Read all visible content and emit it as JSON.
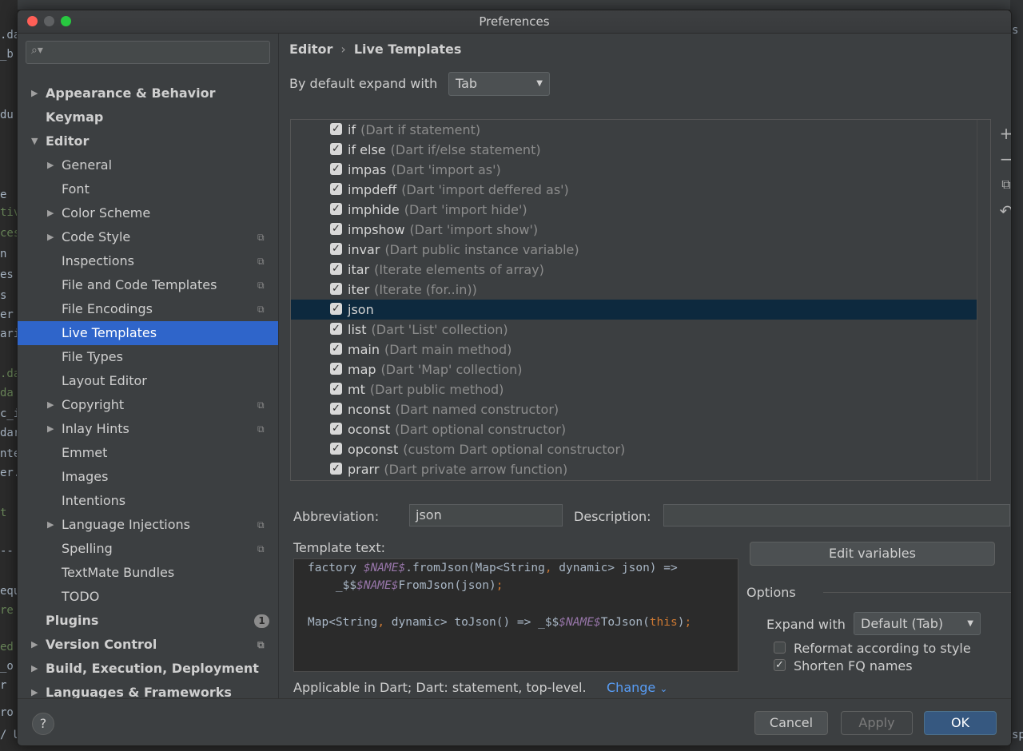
{
  "window": {
    "title": "Preferences"
  },
  "background": {
    "fragments": [
      ".da",
      "_b",
      "du",
      "e",
      "tiv",
      "ces",
      "n",
      "es",
      "s",
      "er",
      "ari",
      ".da",
      "da",
      "c_i",
      "dar",
      "nte",
      "er.",
      "t",
      "--",
      "equ",
      "re",
      "ed",
      "_o",
      "r ",
      "ro",
      "/ U"
    ],
    "right_fragments": [
      "s",
      "sp"
    ]
  },
  "sidebar": {
    "search_placeholder": "",
    "items": [
      {
        "label": "Appearance & Behavior",
        "level": 0,
        "arrow": "right",
        "bold": true
      },
      {
        "label": "Keymap",
        "level": 0,
        "arrow": "none",
        "bold": true
      },
      {
        "label": "Editor",
        "level": 0,
        "arrow": "down",
        "bold": true
      },
      {
        "label": "General",
        "level": 1,
        "arrow": "right"
      },
      {
        "label": "Font",
        "level": 1,
        "arrow": "none"
      },
      {
        "label": "Color Scheme",
        "level": 1,
        "arrow": "right"
      },
      {
        "label": "Code Style",
        "level": 1,
        "arrow": "right",
        "copy": true
      },
      {
        "label": "Inspections",
        "level": 1,
        "arrow": "none",
        "copy": true
      },
      {
        "label": "File and Code Templates",
        "level": 1,
        "arrow": "none",
        "copy": true
      },
      {
        "label": "File Encodings",
        "level": 1,
        "arrow": "none",
        "copy": true
      },
      {
        "label": "Live Templates",
        "level": 1,
        "arrow": "none",
        "selected": true
      },
      {
        "label": "File Types",
        "level": 1,
        "arrow": "none"
      },
      {
        "label": "Layout Editor",
        "level": 1,
        "arrow": "none"
      },
      {
        "label": "Copyright",
        "level": 1,
        "arrow": "right",
        "copy": true
      },
      {
        "label": "Inlay Hints",
        "level": 1,
        "arrow": "right",
        "copy": true
      },
      {
        "label": "Emmet",
        "level": 1,
        "arrow": "none"
      },
      {
        "label": "Images",
        "level": 1,
        "arrow": "none"
      },
      {
        "label": "Intentions",
        "level": 1,
        "arrow": "none"
      },
      {
        "label": "Language Injections",
        "level": 1,
        "arrow": "right",
        "copy": true
      },
      {
        "label": "Spelling",
        "level": 1,
        "arrow": "none",
        "copy": true
      },
      {
        "label": "TextMate Bundles",
        "level": 1,
        "arrow": "none"
      },
      {
        "label": "TODO",
        "level": 1,
        "arrow": "none"
      },
      {
        "label": "Plugins",
        "level": 0,
        "arrow": "none",
        "bold": true,
        "badge": "1"
      },
      {
        "label": "Version Control",
        "level": 0,
        "arrow": "right",
        "bold": true,
        "copy": true
      },
      {
        "label": "Build, Execution, Deployment",
        "level": 0,
        "arrow": "right",
        "bold": true
      },
      {
        "label": "Languages & Frameworks",
        "level": 0,
        "arrow": "right",
        "bold": true
      }
    ]
  },
  "breadcrumb": {
    "part1": "Editor",
    "separator": "›",
    "part2": "Live Templates"
  },
  "expand": {
    "label": "By default expand with",
    "value": "Tab"
  },
  "templates": [
    {
      "abbr": "if",
      "desc": "(Dart if statement)",
      "checked": true
    },
    {
      "abbr": "if else",
      "desc": "(Dart if/else statement)",
      "checked": true
    },
    {
      "abbr": "impas",
      "desc": "(Dart 'import as')",
      "checked": true
    },
    {
      "abbr": "impdeff",
      "desc": "(Dart 'import deffered as')",
      "checked": true
    },
    {
      "abbr": "imphide",
      "desc": "(Dart 'import hide')",
      "checked": true
    },
    {
      "abbr": "impshow",
      "desc": "(Dart 'import show')",
      "checked": true
    },
    {
      "abbr": "invar",
      "desc": "(Dart public instance variable)",
      "checked": true
    },
    {
      "abbr": "itar",
      "desc": "(Iterate elements of array)",
      "checked": true
    },
    {
      "abbr": "iter",
      "desc": "(Iterate (for..in))",
      "checked": true
    },
    {
      "abbr": "json",
      "desc": "",
      "checked": true,
      "selected": true
    },
    {
      "abbr": "list",
      "desc": "(Dart 'List' collection)",
      "checked": true
    },
    {
      "abbr": "main",
      "desc": "(Dart main method)",
      "checked": true
    },
    {
      "abbr": "map",
      "desc": "(Dart 'Map' collection)",
      "checked": true
    },
    {
      "abbr": "mt",
      "desc": "(Dart public method)",
      "checked": true
    },
    {
      "abbr": "nconst",
      "desc": "(Dart named constructor)",
      "checked": true
    },
    {
      "abbr": "oconst",
      "desc": "(Dart optional constructor)",
      "checked": true
    },
    {
      "abbr": "opconst",
      "desc": "(custom Dart optional constructor)",
      "checked": true
    },
    {
      "abbr": "prarr",
      "desc": "(Dart private arrow function)",
      "checked": true
    }
  ],
  "list_tools": {
    "add": "+",
    "remove": "−",
    "copy": "⧉",
    "restore": "↶"
  },
  "details": {
    "abbreviation_label": "Abbreviation:",
    "abbreviation_value": "json",
    "description_label": "Description:",
    "description_value": "",
    "template_text_label": "Template text:",
    "code": {
      "l1_a": "factory ",
      "l1_var": "$NAME$",
      "l1_b": ".fromJson(Map<String",
      "l1_comma": ",",
      "l1_c": " dynamic> json) =>",
      "l2_a": "    _$$",
      "l2_var": "$NAME$",
      "l2_b": "FromJson(json)",
      "l2_semi": ";",
      "l3_a": "Map<String",
      "l3_comma": ",",
      "l3_b": " dynamic> toJson() => _$$",
      "l3_var": "$NAME$",
      "l3_c": "ToJson(",
      "l3_this": "this",
      "l3_d": ")",
      "l3_semi": ";"
    },
    "applicable_text": "Applicable in Dart; Dart: statement, top-level.",
    "change_link": "Change",
    "change_caret": "⌄"
  },
  "options": {
    "edit_variables": "Edit variables",
    "title": "Options",
    "expand_label": "Expand with",
    "expand_value": "Default (Tab)",
    "reformat_label": "Reformat according to style",
    "reformat_checked": false,
    "shorten_label": "Shorten FQ names",
    "shorten_checked": true
  },
  "footer": {
    "help": "?",
    "cancel": "Cancel",
    "apply": "Apply",
    "ok": "OK"
  },
  "colors": {
    "selection": "#2f65ca",
    "list_selection": "#0d293e",
    "accent_link": "#589df6",
    "ok_button": "#365880"
  }
}
